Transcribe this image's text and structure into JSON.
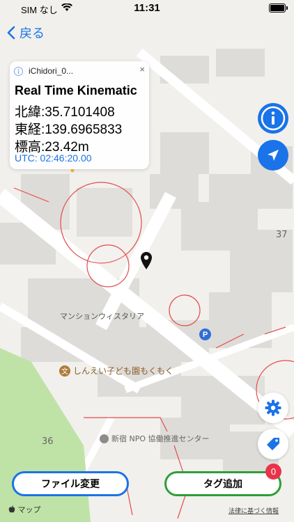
{
  "status_bar": {
    "carrier": "SIM なし",
    "time": "11:31"
  },
  "nav": {
    "back_label": "戻る"
  },
  "info_card": {
    "device_name": "iChidori_0...",
    "close_label": "×",
    "fix_type": "Real Time Kinematic",
    "latitude": "北緯:35.7101408",
    "longitude": "東経:139.6965833",
    "altitude": "標高:23.42m",
    "utc": "UTC: 02:46:20.00"
  },
  "map": {
    "building_label": "マンションウィスタリア",
    "poi_kindergarten": "しんえい子ども園もくもく",
    "poi_kindergarten_glyph": "文",
    "poi_center": "新宿 NPO 協働推進センター",
    "block_37": "37",
    "block_36": "36",
    "parking_glyph": "P"
  },
  "buttons": {
    "file_change": "ファイル変更",
    "add_tag": "タグ追加",
    "tag_badge": "0"
  },
  "footer": {
    "maps_attribution": "マップ",
    "legal_link": "法律に基づく情報"
  },
  "colors": {
    "accent_blue": "#1a73e8",
    "tag_green": "#2e9e3a",
    "badge_red": "#e8334a",
    "circle_red": "#e34b4b",
    "park_green": "#7fc66b"
  },
  "icons": {
    "back": "chevron-left-icon",
    "info": "info-icon",
    "locate": "location-arrow-icon",
    "settings": "gear-icon",
    "tag": "tag-icon",
    "pin": "map-pin-icon"
  }
}
